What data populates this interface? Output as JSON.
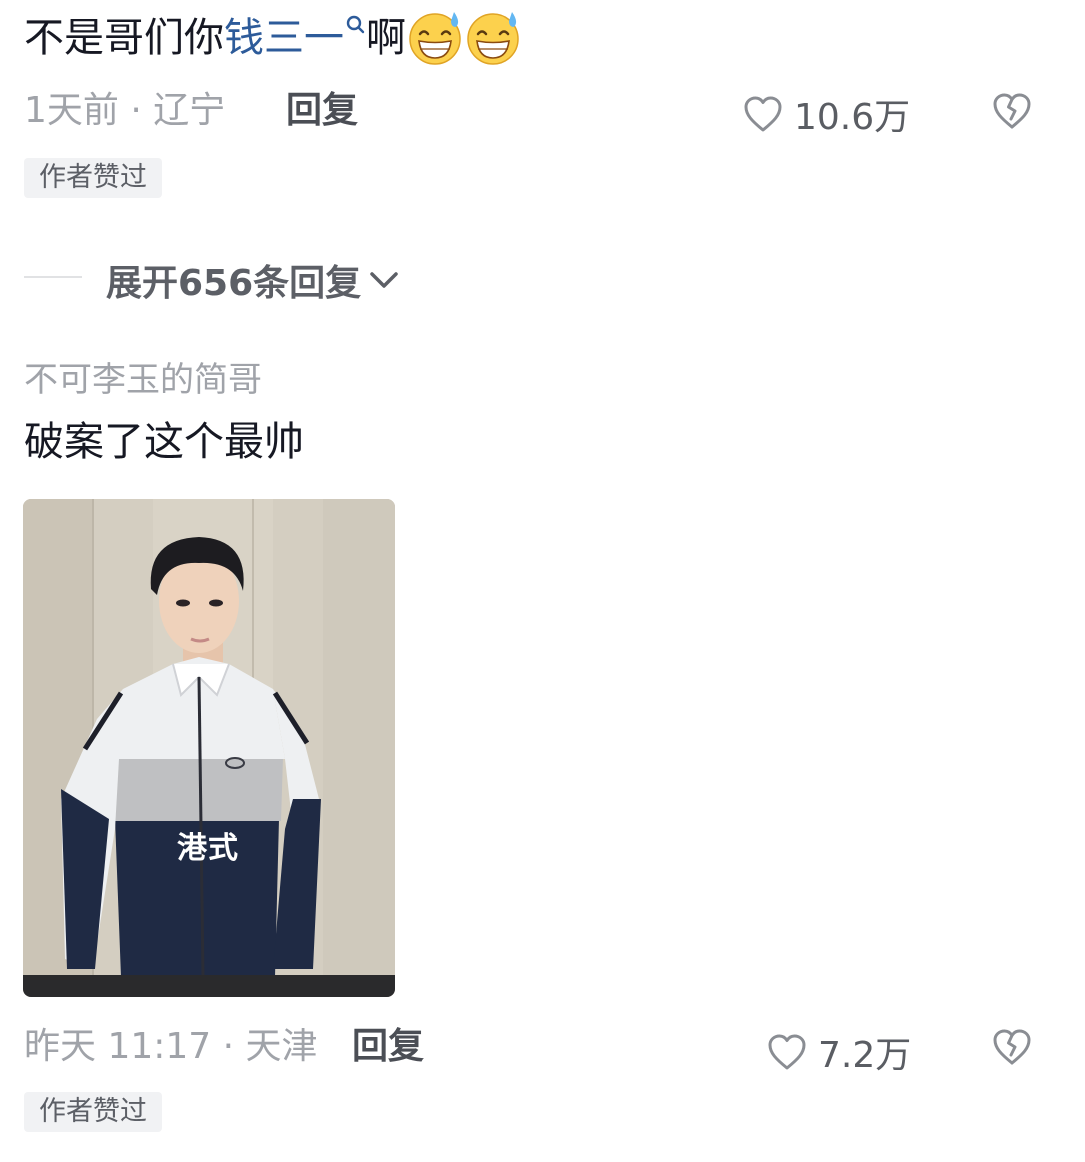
{
  "comment1": {
    "text_before": "不是哥们你",
    "link_text": "钱三一",
    "text_after": "啊",
    "emoji": "grinning-sweat-emoji",
    "time_location": "1天前 · 辽宁",
    "reply_label": "回复",
    "like_count": "10.6万",
    "author_badge": "作者赞过"
  },
  "expand_replies": {
    "label": "展开656条回复"
  },
  "comment2": {
    "username": "不可李玉的简哥",
    "text": "破案了这个最帅",
    "image_caption": "港式",
    "time_location": "昨天 11:17 · 天津",
    "reply_label": "回复",
    "like_count": "7.2万",
    "author_badge": "作者赞过"
  },
  "colors": {
    "link": "#2d5b9a",
    "meta_text": "#a0a3a9",
    "badge_bg": "#f1f2f4",
    "primary_text": "#161823"
  }
}
